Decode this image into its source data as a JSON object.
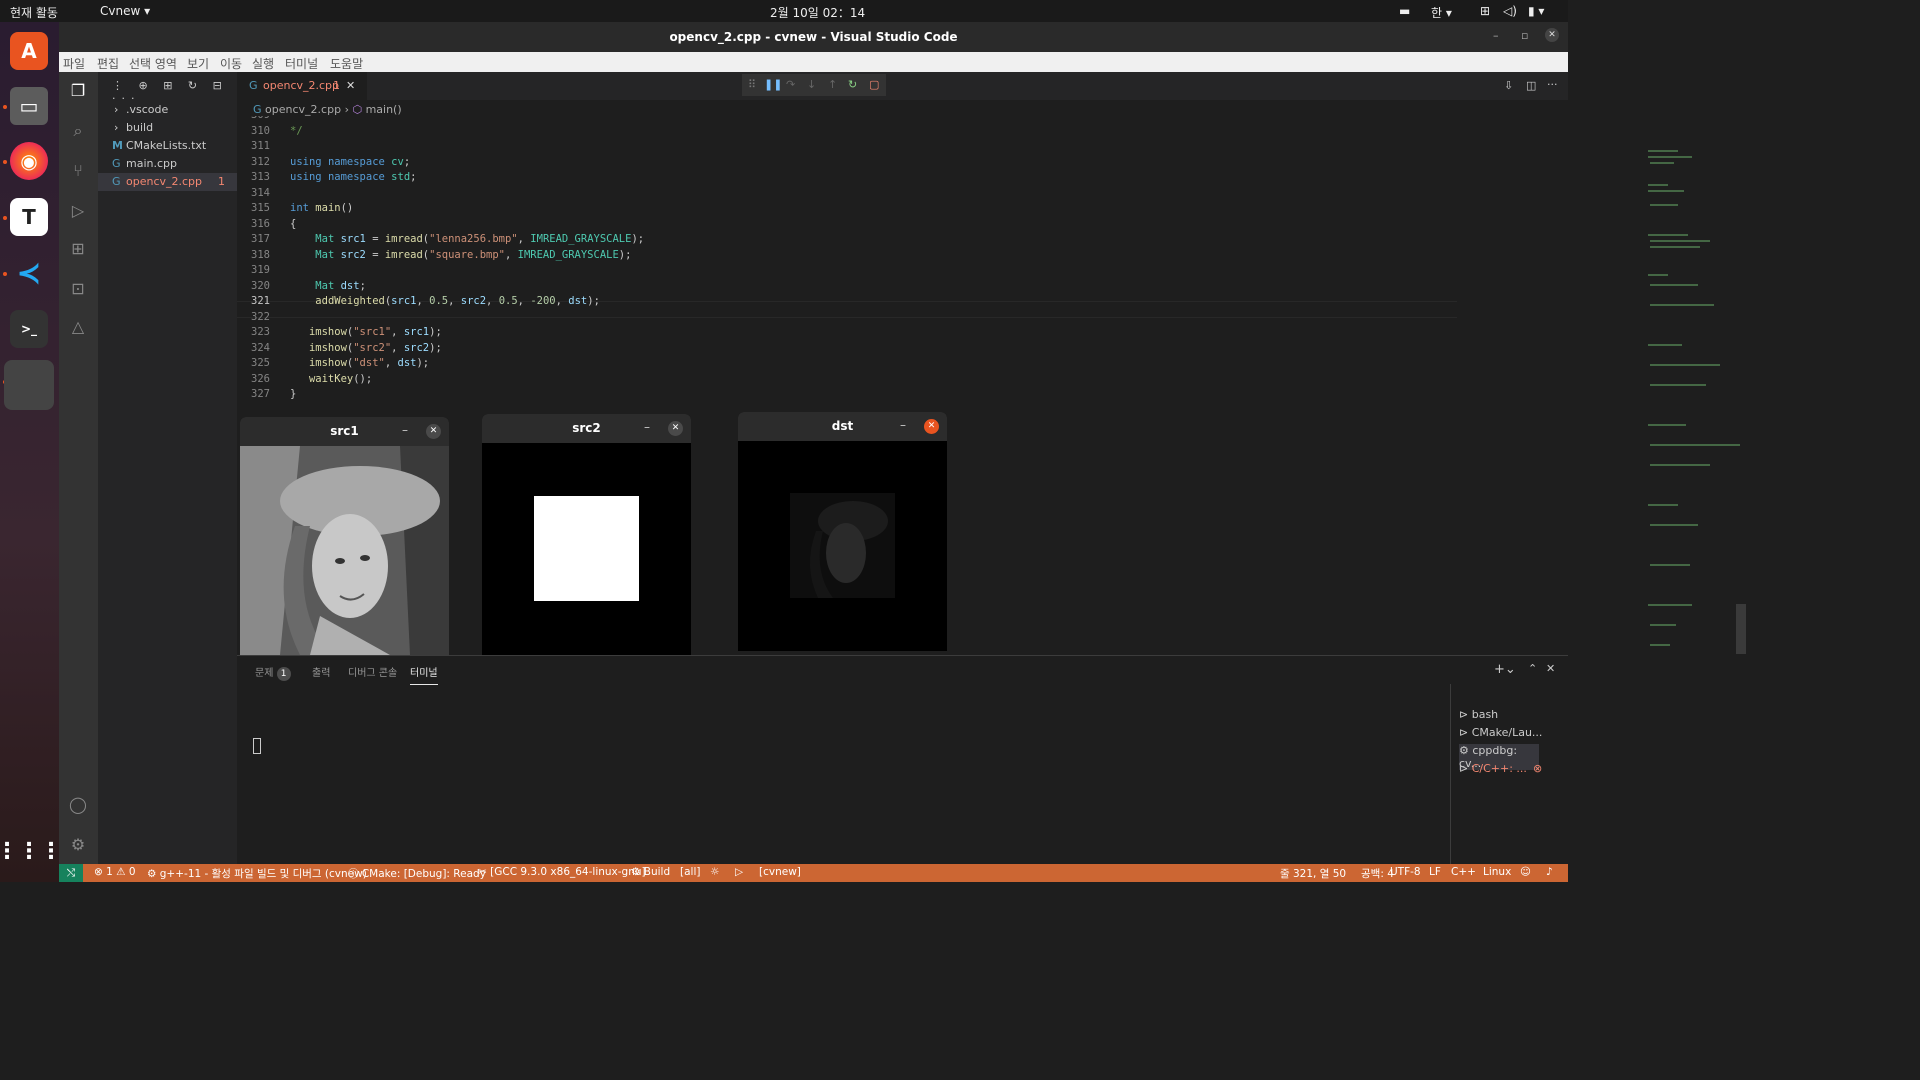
{
  "topbar": {
    "activities": "현재 활동",
    "app_menu": "Cvnew",
    "clock": "2월 10일  02：14",
    "input_method": "한"
  },
  "window": {
    "title": "opencv_2.cpp - cvnew - Visual Studio Code"
  },
  "menu": [
    "파일",
    "편집",
    "선택 영역",
    "보기",
    "이동",
    "실행",
    "터미널",
    "도움말"
  ],
  "sidebar": {
    "items": [
      {
        "label": ".vscode",
        "kind": "folder"
      },
      {
        "label": "build",
        "kind": "folder"
      },
      {
        "label": "CMakeLists.txt",
        "kind": "cmake"
      },
      {
        "label": "main.cpp",
        "kind": "cpp"
      },
      {
        "label": "opencv_2.cpp",
        "kind": "cpp",
        "badge": "1"
      }
    ]
  },
  "editor": {
    "tab_label": "opencv_2.cpp",
    "tab_badge": "1",
    "breadcrumb_file": "opencv_2.cpp",
    "breadcrumb_symbol": "main()",
    "active_line": "321",
    "lines": [
      {
        "n": "309",
        "text": ""
      },
      {
        "n": "310",
        "text": "*/"
      },
      {
        "n": "311",
        "text": ""
      },
      {
        "n": "312",
        "text": "using namespace cv;"
      },
      {
        "n": "313",
        "text": "using namespace std;"
      },
      {
        "n": "314",
        "text": ""
      },
      {
        "n": "315",
        "text": "int main()"
      },
      {
        "n": "316",
        "text": "{"
      },
      {
        "n": "317",
        "text": "    Mat src1 = imread(\"lenna256.bmp\", IMREAD_GRAYSCALE);"
      },
      {
        "n": "318",
        "text": "    Mat src2 = imread(\"square.bmp\", IMREAD_GRAYSCALE);"
      },
      {
        "n": "319",
        "text": ""
      },
      {
        "n": "320",
        "text": "    Mat dst;"
      },
      {
        "n": "321",
        "text": "    addWeighted(src1, 0.5, src2, 0.5, -200, dst);"
      },
      {
        "n": "322",
        "text": ""
      },
      {
        "n": "323",
        "text": "   imshow(\"src1\", src1);"
      },
      {
        "n": "324",
        "text": "   imshow(\"src2\", src2);"
      },
      {
        "n": "325",
        "text": "   imshow(\"dst\", dst);"
      },
      {
        "n": "326",
        "text": "   waitKey();"
      },
      {
        "n": "327",
        "text": "}"
      }
    ]
  },
  "cv_windows": [
    {
      "title": "src1"
    },
    {
      "title": "src2"
    },
    {
      "title": "dst"
    }
  ],
  "panel": {
    "tabs": [
      {
        "label": "문제",
        "badge": "1"
      },
      {
        "label": "출력"
      },
      {
        "label": "디버그 콘솔"
      },
      {
        "label": "터미널",
        "active": true
      }
    ],
    "terminals": [
      {
        "label": "bash"
      },
      {
        "label": "CMake/Lau..."
      },
      {
        "label": "cppdbg: cv..."
      },
      {
        "label": "C/C++: ..."
      }
    ]
  },
  "statusbar": {
    "errors": "1",
    "warnings": "0",
    "build_task": "g++-11 - 활성 파일 빌드 및 디버그 (cvnew)",
    "cmake_status": "CMake: [Debug]: Ready",
    "kit": "[GCC 9.3.0 x86_64-linux-gnu]",
    "build": "Build",
    "target": "[all]",
    "project": "[cvnew]",
    "cursor": "줄 321, 열 50",
    "indent": "공백: 4",
    "encoding": "UTF-8",
    "eol": "LF",
    "language": "C++",
    "platform": "Linux"
  },
  "colors": {
    "statusbar": "#cc6633",
    "accent": "#e95420",
    "error_file": "#f48771"
  }
}
